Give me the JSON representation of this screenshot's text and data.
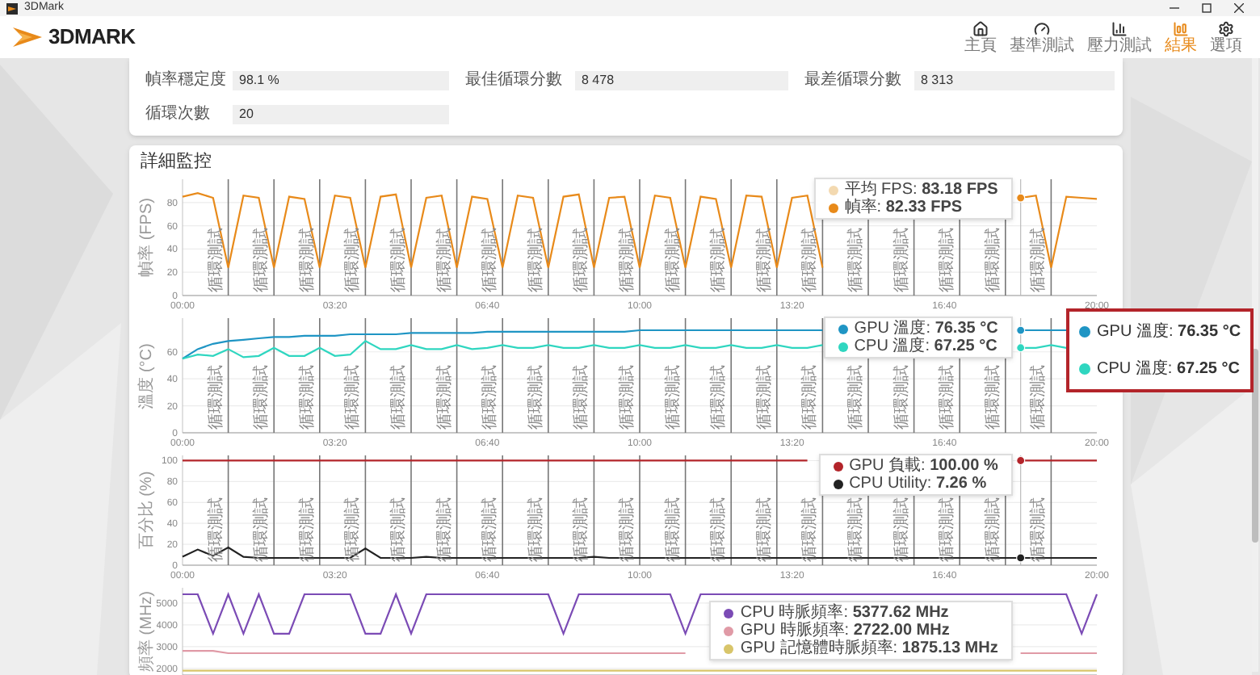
{
  "window": {
    "title": "3DMark"
  },
  "header": {
    "logo": "3DMARK",
    "nav": [
      {
        "kind": "home",
        "label": "主頁",
        "selected": false
      },
      {
        "kind": "gauge",
        "label": "基準測試",
        "selected": false
      },
      {
        "kind": "bars",
        "label": "壓力測試",
        "selected": false
      },
      {
        "kind": "results",
        "label": "結果",
        "selected": true
      },
      {
        "kind": "gear",
        "label": "選項",
        "selected": false
      }
    ]
  },
  "summary": {
    "fields": [
      {
        "label": "幀率穩定度",
        "value": "98.1 %"
      },
      {
        "label": "最佳循環分數",
        "value": "8 478"
      },
      {
        "label": "最差循環分數",
        "value": "8 313"
      },
      {
        "label": "循環次數",
        "value": "20"
      }
    ]
  },
  "monitoring": {
    "title": "詳細監控",
    "charts": [
      {
        "extra": [
          {
            "label": "平均 FPS",
            "value": ": **83.18 FPS**",
            "color": "#f3d9b0"
          }
        ],
        "readings": [
          ": **82.33 FPS**"
        ],
        "chart_data": {
          "type": "line",
          "ylabel": "幀率 (FPS)",
          "grid": true,
          "x": [
            0,
            20,
            40,
            60,
            80,
            100,
            120,
            140,
            160,
            180,
            200,
            220,
            240,
            260,
            280,
            300,
            320,
            340,
            360,
            380,
            400,
            420,
            440,
            460,
            480,
            500,
            520,
            540,
            560,
            580,
            600,
            620,
            640,
            660,
            680,
            700,
            720,
            740,
            760,
            780,
            800,
            820,
            840,
            860,
            880,
            900,
            920,
            940,
            960,
            980,
            1000,
            1020,
            1040,
            1060,
            1080,
            1100,
            1120,
            1140,
            1160,
            1180,
            1200
          ],
          "xlim": [
            0,
            1200
          ],
          "ylim": [
            0,
            100
          ],
          "yticks": [
            0,
            20,
            40,
            60,
            80
          ],
          "xticks": [
            {
              "value": 0,
              "label": "00:00"
            },
            {
              "value": 200,
              "label": "03:20"
            },
            {
              "value": 400,
              "label": "06:40"
            },
            {
              "value": 600,
              "label": "10:00"
            },
            {
              "value": 800,
              "label": "13:20"
            },
            {
              "value": 1000,
              "label": "16:40"
            },
            {
              "value": 1200,
              "label": "20:00"
            }
          ],
          "series": [
            {
              "name": "幀率",
              "color": "#e88a1a",
              "values": [
                85,
                88,
                84,
                24,
                86,
                84,
                24,
                85,
                83,
                24,
                86,
                84,
                24,
                85,
                87,
                24,
                84,
                86,
                24,
                85,
                83,
                24,
                86,
                84,
                24,
                85,
                87,
                24,
                84,
                85,
                24,
                86,
                84,
                24,
                85,
                83,
                24,
                86,
                85,
                24,
                84,
                86,
                24,
                null,
                null,
                null,
                null,
                null,
                null,
                null,
                null,
                null,
                null,
                null,
                null,
                84,
                86,
                24,
                85,
                84,
                83
              ]
            }
          ],
          "ref_lines": [
            {
              "axis": "x",
              "value": 60,
              "label": "循環測試"
            },
            {
              "axis": "x",
              "value": 120,
              "label": "循環測試"
            },
            {
              "axis": "x",
              "value": 180,
              "label": "循環測試"
            },
            {
              "axis": "x",
              "value": 240,
              "label": "循環測試"
            },
            {
              "axis": "x",
              "value": 300,
              "label": "循環測試"
            },
            {
              "axis": "x",
              "value": 360,
              "label": "循環測試"
            },
            {
              "axis": "x",
              "value": 420,
              "label": "循環測試"
            },
            {
              "axis": "x",
              "value": 480,
              "label": "循環測試"
            },
            {
              "axis": "x",
              "value": 540,
              "label": "循環測試"
            },
            {
              "axis": "x",
              "value": 600,
              "label": "循環測試"
            },
            {
              "axis": "x",
              "value": 660,
              "label": "循環測試"
            },
            {
              "axis": "x",
              "value": 720,
              "label": "循環測試"
            },
            {
              "axis": "x",
              "value": 780,
              "label": "循環測試"
            },
            {
              "axis": "x",
              "value": 840,
              "label": "循環測試"
            },
            {
              "axis": "x",
              "value": 900,
              "label": "循環測試"
            },
            {
              "axis": "x",
              "value": 960,
              "label": "循環測試"
            },
            {
              "axis": "x",
              "value": 1020,
              "label": "循環測試"
            },
            {
              "axis": "x",
              "value": 1080,
              "label": "循環測試"
            },
            {
              "axis": "x",
              "value": 1140,
              "label": "循環測試"
            },
            {
              "axis": "x",
              "value": 1100
            }
          ]
        }
      },
      {
        "readings": [
          ": **76.35 °C**",
          ": **67.25 °C**"
        ],
        "chart_data": {
          "type": "line",
          "ylabel": "溫度 (°C)",
          "grid": true,
          "x": [
            0,
            20,
            40,
            60,
            80,
            100,
            120,
            140,
            160,
            180,
            200,
            220,
            240,
            260,
            280,
            300,
            320,
            340,
            360,
            380,
            400,
            420,
            440,
            460,
            480,
            500,
            520,
            540,
            560,
            580,
            600,
            620,
            640,
            660,
            680,
            700,
            720,
            740,
            760,
            780,
            800,
            820,
            840,
            860,
            880,
            900,
            920,
            940,
            960,
            980,
            1000,
            1020,
            1040,
            1060,
            1080,
            1100,
            1120,
            1140,
            1160
          ],
          "xlim": [
            0,
            1200
          ],
          "ylim": [
            0,
            85
          ],
          "yticks": [
            0,
            20,
            40,
            60
          ],
          "xticks": [
            {
              "value": 0,
              "label": "00:00"
            },
            {
              "value": 200,
              "label": "03:20"
            },
            {
              "value": 400,
              "label": "06:40"
            },
            {
              "value": 600,
              "label": "10:00"
            },
            {
              "value": 800,
              "label": "13:20"
            },
            {
              "value": 1000,
              "label": "16:40"
            },
            {
              "value": 1200,
              "label": "20:00"
            }
          ],
          "series": [
            {
              "name": "GPU 溫度",
              "color": "#1f95c4",
              "values": [
                55,
                62,
                66,
                68,
                69,
                70,
                71,
                71,
                72,
                72,
                72,
                73,
                73,
                73,
                73,
                74,
                74,
                74,
                74,
                74,
                75,
                75,
                75,
                75,
                75,
                75,
                75,
                75,
                75,
                75,
                76,
                76,
                76,
                76,
                76,
                76,
                76,
                76,
                76,
                76,
                76,
                76,
                76,
                null,
                null,
                null,
                null,
                null,
                null,
                null,
                null,
                null,
                null,
                null,
                null,
                76,
                76,
                76,
                76
              ]
            },
            {
              "name": "CPU 溫度",
              "color": "#2fd6c0",
              "values": [
                55,
                58,
                57,
                62,
                56,
                57,
                63,
                57,
                57,
                63,
                57,
                58,
                68,
                62,
                62,
                65,
                62,
                62,
                65,
                62,
                63,
                65,
                63,
                63,
                65,
                63,
                63,
                65,
                63,
                63,
                65,
                63,
                63,
                65,
                63,
                63,
                65,
                63,
                63,
                65,
                63,
                63,
                65,
                null,
                null,
                null,
                null,
                null,
                null,
                null,
                null,
                null,
                null,
                null,
                null,
                63,
                63,
                65,
                63
              ]
            }
          ],
          "ref_lines": [
            {
              "axis": "x",
              "value": 60,
              "label": "循環測試"
            },
            {
              "axis": "x",
              "value": 120,
              "label": "循環測試"
            },
            {
              "axis": "x",
              "value": 180,
              "label": "循環測試"
            },
            {
              "axis": "x",
              "value": 240,
              "label": "循環測試"
            },
            {
              "axis": "x",
              "value": 300,
              "label": "循環測試"
            },
            {
              "axis": "x",
              "value": 360,
              "label": "循環測試"
            },
            {
              "axis": "x",
              "value": 420,
              "label": "循環測試"
            },
            {
              "axis": "x",
              "value": 480,
              "label": "循環測試"
            },
            {
              "axis": "x",
              "value": 540,
              "label": "循環測試"
            },
            {
              "axis": "x",
              "value": 600,
              "label": "循環測試"
            },
            {
              "axis": "x",
              "value": 660,
              "label": "循環測試"
            },
            {
              "axis": "x",
              "value": 720,
              "label": "循環測試"
            },
            {
              "axis": "x",
              "value": 780,
              "label": "循環測試"
            },
            {
              "axis": "x",
              "value": 840,
              "label": "循環測試"
            },
            {
              "axis": "x",
              "value": 900,
              "label": "循環測試"
            },
            {
              "axis": "x",
              "value": 960,
              "label": "循環測試"
            },
            {
              "axis": "x",
              "value": 1020,
              "label": "循環測試"
            },
            {
              "axis": "x",
              "value": 1080,
              "label": "循環測試"
            },
            {
              "axis": "x",
              "value": 1140,
              "label": "循環測試"
            },
            {
              "axis": "x",
              "value": 1100
            }
          ]
        }
      },
      {
        "readings": [
          ": **100.00 %**",
          ": **7.26 %**"
        ],
        "chart_data": {
          "type": "line",
          "ylabel": "百分比 (%)",
          "grid": true,
          "x": [
            0,
            20,
            40,
            60,
            80,
            100,
            120,
            140,
            160,
            180,
            200,
            220,
            240,
            260,
            280,
            300,
            320,
            340,
            360,
            380,
            400,
            420,
            440,
            460,
            480,
            500,
            520,
            540,
            560,
            580,
            600,
            620,
            640,
            660,
            680,
            700,
            720,
            740,
            760,
            780,
            800,
            820,
            840,
            860,
            880,
            900,
            920,
            940,
            960,
            980,
            1000,
            1020,
            1040,
            1060,
            1080,
            1100,
            1120,
            1140,
            1160,
            1180,
            1200
          ],
          "xlim": [
            0,
            1200
          ],
          "ylim": [
            0,
            105
          ],
          "yticks": [
            0,
            20,
            40,
            60,
            80,
            100
          ],
          "xticks": [
            {
              "value": 0,
              "label": "00:00"
            },
            {
              "value": 200,
              "label": "03:20"
            },
            {
              "value": 400,
              "label": "06:40"
            },
            {
              "value": 600,
              "label": "10:00"
            },
            {
              "value": 800,
              "label": "13:20"
            },
            {
              "value": 1000,
              "label": "16:40"
            },
            {
              "value": 1200,
              "label": "20:00"
            }
          ],
          "series": [
            {
              "name": "GPU 負載",
              "color": "#b3242a",
              "values": [
                100,
                100,
                100,
                100,
                100,
                100,
                100,
                100,
                100,
                100,
                100,
                100,
                100,
                100,
                100,
                100,
                100,
                100,
                100,
                100,
                100,
                100,
                100,
                100,
                100,
                100,
                100,
                100,
                100,
                100,
                100,
                100,
                100,
                100,
                100,
                100,
                100,
                100,
                100,
                100,
                100,
                100,
                null,
                null,
                null,
                null,
                null,
                null,
                null,
                null,
                null,
                null,
                null,
                null,
                null,
                100,
                100,
                100,
                100,
                100,
                100
              ]
            },
            {
              "name": "CPU Utility",
              "color": "#222222",
              "values": [
                8,
                15,
                9,
                17,
                8,
                7,
                7,
                7,
                7,
                7,
                7,
                7,
                16,
                7,
                7,
                7,
                8,
                7,
                7,
                7,
                7,
                7,
                7,
                7,
                7,
                7,
                7,
                8,
                7,
                7,
                7,
                7,
                7,
                7,
                7,
                7,
                7,
                7,
                7,
                7,
                7,
                7,
                7,
                7,
                7,
                7,
                7,
                7,
                7,
                7,
                7,
                7,
                7,
                7,
                7,
                7,
                7,
                7,
                7,
                7,
                7
              ]
            }
          ],
          "ref_lines": [
            {
              "axis": "x",
              "value": 60,
              "label": "循環測試"
            },
            {
              "axis": "x",
              "value": 120,
              "label": "循環測試"
            },
            {
              "axis": "x",
              "value": 180,
              "label": "循環測試"
            },
            {
              "axis": "x",
              "value": 240,
              "label": "循環測試"
            },
            {
              "axis": "x",
              "value": 300,
              "label": "循環測試"
            },
            {
              "axis": "x",
              "value": 360,
              "label": "循環測試"
            },
            {
              "axis": "x",
              "value": 420,
              "label": "循環測試"
            },
            {
              "axis": "x",
              "value": 480,
              "label": "循環測試"
            },
            {
              "axis": "x",
              "value": 540,
              "label": "循環測試"
            },
            {
              "axis": "x",
              "value": 600,
              "label": "循環測試"
            },
            {
              "axis": "x",
              "value": 660,
              "label": "循環測試"
            },
            {
              "axis": "x",
              "value": 720,
              "label": "循環測試"
            },
            {
              "axis": "x",
              "value": 780,
              "label": "循環測試"
            },
            {
              "axis": "x",
              "value": 840,
              "label": "循環測試"
            },
            {
              "axis": "x",
              "value": 900,
              "label": "循環測試"
            },
            {
              "axis": "x",
              "value": 960,
              "label": "循環測試"
            },
            {
              "axis": "x",
              "value": 1020,
              "label": "循環測試"
            },
            {
              "axis": "x",
              "value": 1080,
              "label": "循環測試"
            },
            {
              "axis": "x",
              "value": 1140,
              "label": "循環測試"
            },
            {
              "axis": "x",
              "value": 1100
            }
          ]
        }
      },
      {
        "readings": [
          ": **5377.62 MHz**",
          ": **2722.00 MHz**",
          ": **1875.13 MHz**"
        ],
        "chart_data": {
          "type": "line",
          "ylabel": "頻率 (MHz)",
          "grid": true,
          "x": [
            0,
            20,
            40,
            60,
            80,
            100,
            120,
            140,
            160,
            180,
            200,
            220,
            240,
            260,
            280,
            300,
            320,
            340,
            360,
            380,
            400,
            420,
            440,
            460,
            480,
            500,
            520,
            540,
            560,
            580,
            600,
            620,
            640,
            660,
            680,
            700,
            720,
            740,
            760,
            780,
            800,
            820,
            840,
            860,
            880,
            900,
            920,
            940,
            960,
            980,
            1000,
            1020,
            1040,
            1060,
            1080,
            1100,
            1120,
            1140,
            1160,
            1180,
            1200
          ],
          "xlim": [
            0,
            1200
          ],
          "ylim": [
            1700,
            5700
          ],
          "yticks": [
            2000,
            3000,
            4000,
            5000
          ],
          "series": [
            {
              "name": "CPU 時脈頻率",
              "color": "#7b4bb5",
              "values": [
                5400,
                5400,
                3600,
                5400,
                3600,
                5400,
                3600,
                3600,
                5400,
                5400,
                5400,
                5400,
                3600,
                3600,
                5400,
                3600,
                5400,
                5400,
                5400,
                5400,
                5400,
                5400,
                5400,
                5400,
                5400,
                3600,
                5400,
                5400,
                5400,
                5400,
                5400,
                5400,
                5400,
                3600,
                5400,
                5400,
                5400,
                5400,
                5400,
                5400,
                5400,
                5400,
                5400,
                5400,
                5400,
                5400,
                5400,
                5400,
                5400,
                5400,
                5400,
                5400,
                5400,
                5400,
                5400,
                5400,
                5400,
                5400,
                5400,
                3600,
                5400
              ]
            },
            {
              "name": "GPU 時脈頻率",
              "color": "#e09aa6",
              "values": [
                2800,
                2800,
                2800,
                2700,
                2700,
                2700,
                2700,
                2700,
                2700,
                2700,
                2700,
                2700,
                2700,
                2700,
                2700,
                2700,
                2700,
                2700,
                2700,
                2700,
                2700,
                2700,
                2700,
                2700,
                2700,
                2700,
                2700,
                2700,
                2700,
                2700,
                2700,
                2700,
                2700,
                2700,
                null,
                null,
                null,
                null,
                null,
                null,
                null,
                null,
                null,
                null,
                null,
                null,
                null,
                null,
                null,
                null,
                null,
                null,
                null,
                null,
                null,
                2700,
                2700,
                2700,
                2700,
                2700,
                2700
              ]
            },
            {
              "name": "GPU 記憶體時脈頻率",
              "color": "#d8c56a",
              "values": [
                1900,
                1900,
                1900,
                1900,
                1900,
                1900,
                1900,
                1900,
                1900,
                1900,
                1900,
                1900,
                1900,
                1900,
                1900,
                1900,
                1900,
                1900,
                1900,
                1900,
                1900,
                1900,
                1900,
                1900,
                1900,
                1900,
                1900,
                1900,
                1900,
                1900,
                1900,
                1900,
                1900,
                1900,
                1900,
                1900,
                1900,
                1900,
                1900,
                1900,
                1900,
                1900,
                1900,
                1900,
                1900,
                1900,
                1900,
                1900,
                1900,
                1900,
                1900,
                1900,
                1900,
                1900,
                1900,
                1900,
                1900,
                1900,
                1900,
                1900,
                1900
              ]
            }
          ]
        }
      }
    ]
  },
  "callout": [
    {
      "label": "GPU 溫度: **76.35 °C**",
      "color": "#1f95c4"
    },
    {
      "label": "CPU 溫度: **67.25 °C**",
      "color": "#2fd6c0"
    }
  ]
}
